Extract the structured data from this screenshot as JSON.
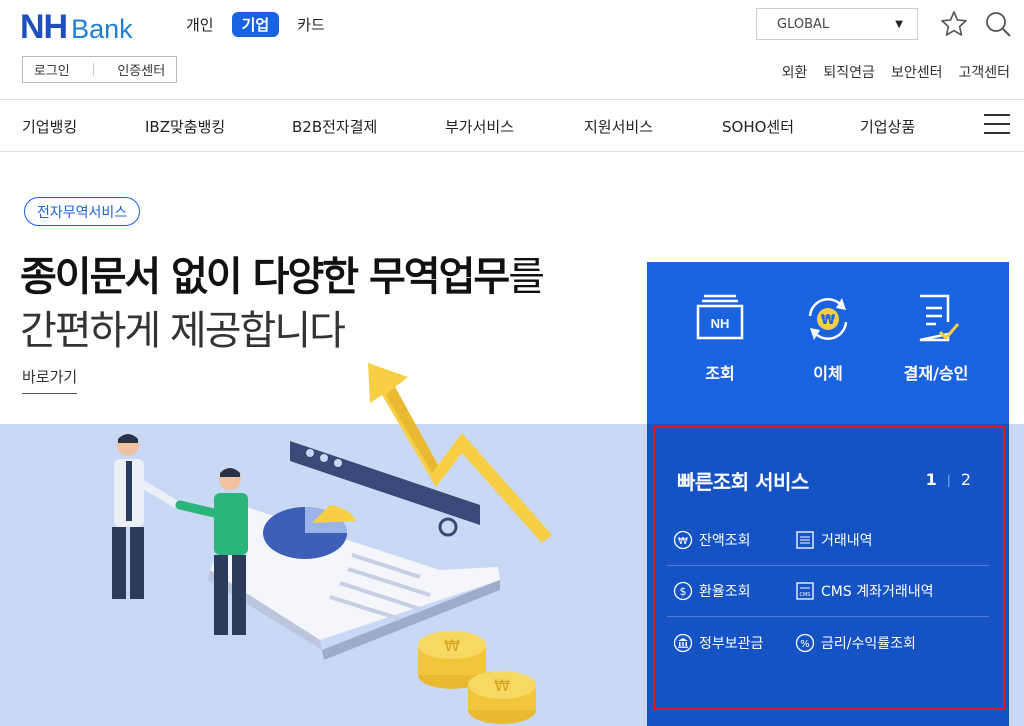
{
  "logo": {
    "nh": "NH",
    "bank": "Bank"
  },
  "segment_tabs": [
    {
      "label": "개인",
      "active": false
    },
    {
      "label": "기업",
      "active": true
    },
    {
      "label": "카드",
      "active": false
    }
  ],
  "auth": {
    "login": "로그인",
    "cert": "인증센터"
  },
  "global_select": {
    "value": "GLOBAL"
  },
  "util_links": [
    "외환",
    "퇴직연금",
    "보안센터",
    "고객센터"
  ],
  "gnb": [
    "기업뱅킹",
    "IBZ맞춤뱅킹",
    "B2B전자결제",
    "부가서비스",
    "지원서비스",
    "SOHO센터",
    "기업상품"
  ],
  "hero": {
    "badge": "전자무역서비스",
    "headline_bold": "종이문서 없이 다양한 무역업무",
    "headline_light": "를",
    "headline2": "간편하게 제공합니다",
    "link": "바로가기"
  },
  "quick_actions": [
    {
      "label": "조회",
      "icon": "nh-inquiry-icon"
    },
    {
      "label": "이체",
      "icon": "won-transfer-icon"
    },
    {
      "label": "결재/승인",
      "icon": "approval-doc-icon"
    }
  ],
  "quick_lookup": {
    "title": "빠른조회 서비스",
    "pages": [
      "1",
      "2"
    ],
    "active_page": "1",
    "items": [
      {
        "label": "잔액조회",
        "icon": "won-circle-icon"
      },
      {
        "label": "거래내역",
        "icon": "list-doc-icon"
      },
      {
        "label": "환율조회",
        "icon": "dollar-circle-icon"
      },
      {
        "label": "CMS 계좌거래내역",
        "icon": "cms-doc-icon"
      },
      {
        "label": "정부보관금",
        "icon": "government-building-icon"
      },
      {
        "label": "금리/수익률조회",
        "icon": "percent-circle-icon"
      }
    ]
  },
  "colors": {
    "brand_blue": "#1a63e0",
    "panel_dark": "#1552c4",
    "hero_bg": "#c9d8f4",
    "highlight": "#e01919"
  }
}
